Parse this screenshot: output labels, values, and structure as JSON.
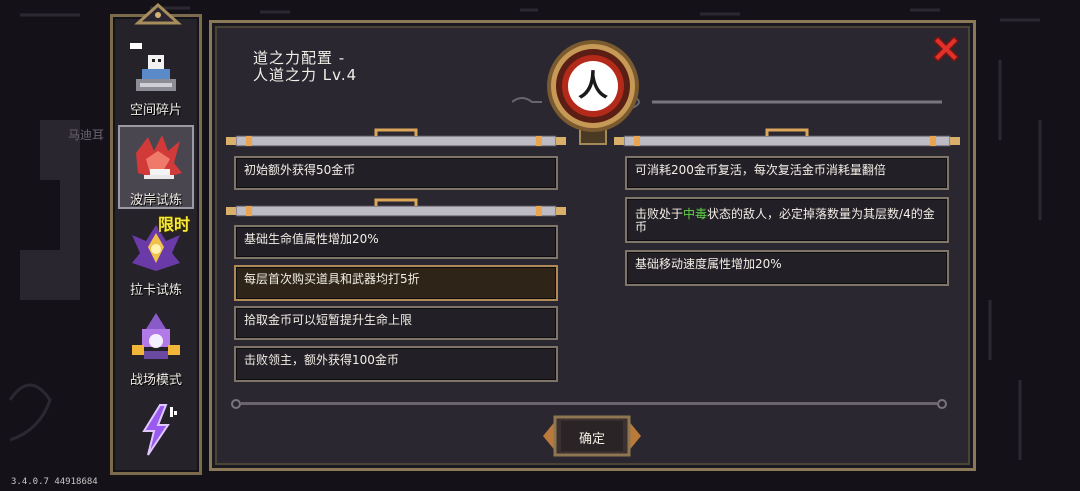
{
  "side_menu": {
    "items": [
      {
        "label": "空间碎片",
        "icon": "space-fragment-icon",
        "active": false
      },
      {
        "label": "波岸试炼",
        "icon": "wave-trial-icon",
        "active": true
      },
      {
        "label": "拉卡试炼",
        "icon": "laka-trial-icon",
        "active": false,
        "badge": "限时"
      },
      {
        "label": "战场模式",
        "icon": "battlefield-icon",
        "active": false
      },
      {
        "label": "",
        "icon": "lightning-icon",
        "active": false
      }
    ]
  },
  "background": {
    "npc_name": "马迪耳"
  },
  "panel": {
    "title": "道之力配置 -\n人道之力 Lv.4",
    "emblem_char": "人",
    "confirm_label": "确定",
    "close_icon": "close-x-icon"
  },
  "effects_left_top": [
    {
      "text": "初始额外获得50金币"
    }
  ],
  "effects_left_bottom": [
    {
      "text": "基础生命值属性增加20%"
    },
    {
      "text": "每层首次购买道具和武器均打5折",
      "highlight": true
    },
    {
      "text": "拾取金币可以短暂提升生命上限"
    },
    {
      "text": "击败领主，额外获得100金币"
    }
  ],
  "effects_right": [
    {
      "text": "可消耗200金币复活，每次复活金币消耗量翻倍"
    },
    {
      "text_before": "击败处于",
      "text_highlight": "中毒",
      "text_after": "状态的敌人，必定掉落数量为其层数/4的金币"
    },
    {
      "text": "基础移动速度属性增加20%"
    }
  ],
  "version": "3.4.0.7 44918684",
  "colors": {
    "panel_bg": "#2a2730",
    "frame_gold": "#8b7856",
    "close_red": "#e0312a",
    "poison_green": "#5fd646",
    "badge_yellow": "#f5ec3a"
  }
}
